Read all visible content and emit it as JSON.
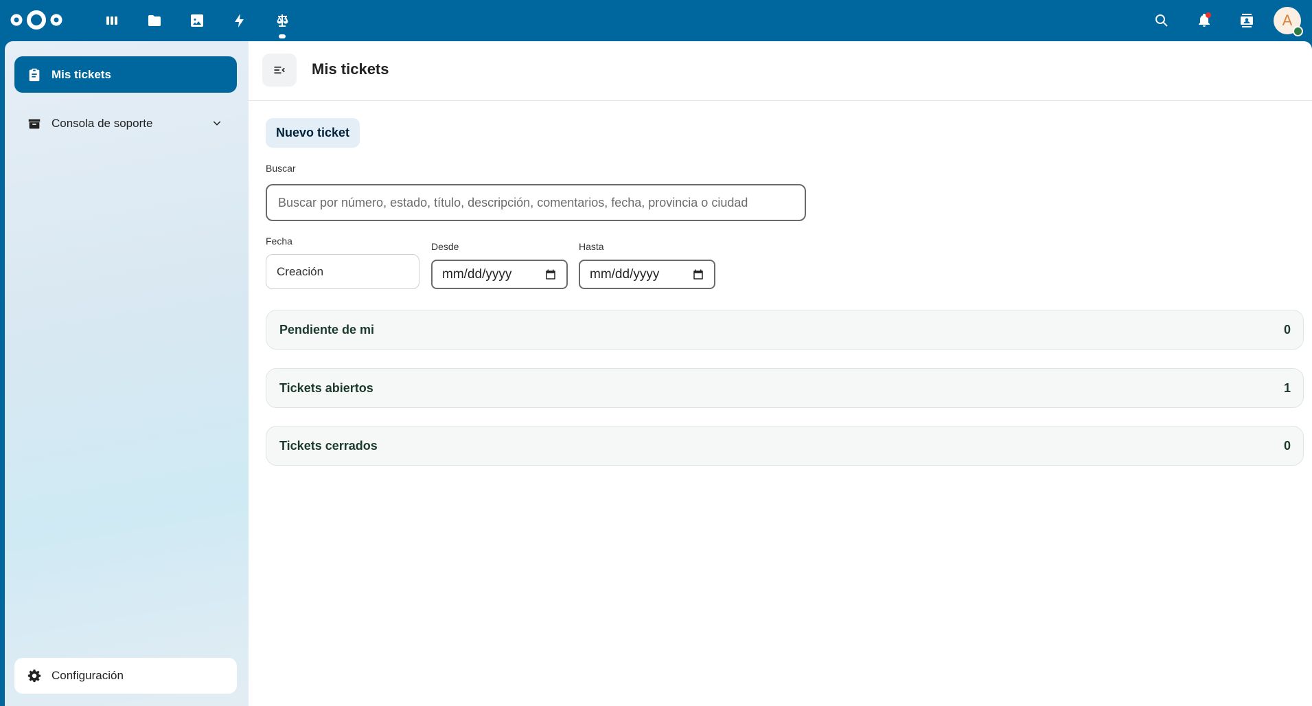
{
  "topbar": {
    "apps": [
      {
        "name": "dashboard-icon"
      },
      {
        "name": "files-icon"
      },
      {
        "name": "photos-icon"
      },
      {
        "name": "activity-icon"
      },
      {
        "name": "tickets-scale-icon"
      }
    ],
    "right_icons": [
      "search-icon",
      "bell-icon",
      "contacts-icon"
    ],
    "avatar_initial": "A"
  },
  "sidebar": {
    "items": [
      {
        "label": "Mis tickets",
        "icon": "clipboard-icon",
        "active": true
      },
      {
        "label": "Consola de soporte",
        "icon": "support-console-icon",
        "active": false,
        "expandable": true
      }
    ],
    "settings_label": "Configuración"
  },
  "main": {
    "title": "Mis tickets",
    "new_ticket_label": "Nuevo ticket",
    "search": {
      "label": "Buscar",
      "placeholder": "Buscar por número, estado, título, descripción, comentarios, fecha, provincia o ciudad",
      "value": ""
    },
    "date_filter": {
      "label": "Fecha",
      "selected": "Creación",
      "from_label": "Desde",
      "from_value": "mm/dd/yyyy",
      "to_label": "Hasta",
      "to_value": "mm/dd/yyyy"
    },
    "sections": [
      {
        "label": "Pendiente de mi",
        "count": "0"
      },
      {
        "label": "Tickets abiertos",
        "count": "1"
      },
      {
        "label": "Tickets cerrados",
        "count": "0"
      }
    ]
  },
  "colors": {
    "primary": "#00679e",
    "accordion_bg": "#f5f8f6",
    "accordion_text": "#1b3a2c"
  }
}
